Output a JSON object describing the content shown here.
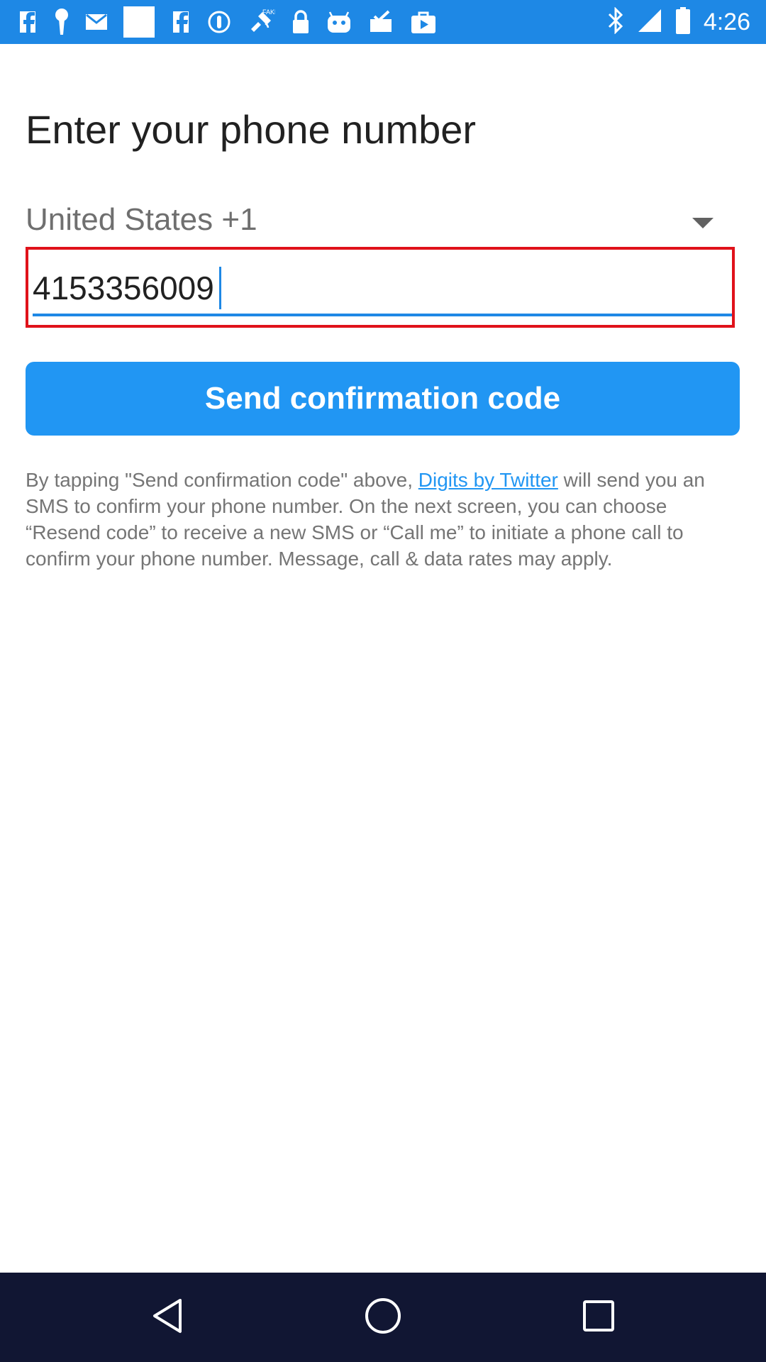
{
  "status_bar": {
    "time": "4:26",
    "left_icons": [
      "facebook-icon",
      "keyhole-icon",
      "mail-icon",
      "blank-notification-icon",
      "facebook-icon",
      "info-icon",
      "fake-gps-icon",
      "lock-icon",
      "android-icon",
      "clipboard-check-icon",
      "play-store-icon"
    ],
    "right_icons": [
      "bluetooth-icon",
      "signal-icon",
      "battery-icon"
    ],
    "background_color": "#1e88e5"
  },
  "page": {
    "title": "Enter your phone number"
  },
  "country_selector": {
    "selected": "United States +1"
  },
  "phone_input": {
    "value": "4153356009"
  },
  "send_button": {
    "label": "Send confirmation code",
    "color": "#2196f3"
  },
  "disclaimer": {
    "prefix": "By tapping \"Send confirmation code\" above, ",
    "link_text": "Digits by Twitter",
    "suffix": " will send you an SMS to confirm your phone number. On the next screen, you can choose “Resend code” to receive a new SMS or “Call me” to initiate a phone call to confirm your phone number. Message, call & data rates may apply."
  },
  "nav_bar": {
    "buttons": [
      "back-icon",
      "home-icon",
      "recents-icon"
    ],
    "background_color": "#111633"
  },
  "highlight_color": "#e0121a"
}
